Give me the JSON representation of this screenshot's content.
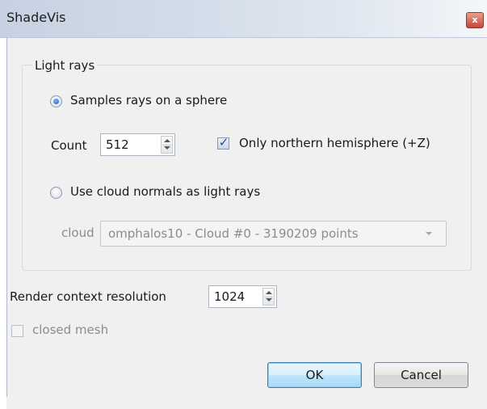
{
  "window": {
    "title": "ShadeVis",
    "close_glyph": "x"
  },
  "light_rays": {
    "group_title": "Light rays",
    "sphere_option": {
      "label": "Samples rays on a sphere",
      "selected": true
    },
    "count": {
      "label": "Count",
      "value": "512"
    },
    "northern": {
      "label": "Only northern hemisphere (+Z)",
      "checked": true
    },
    "normals_option": {
      "label": "Use cloud normals as light rays",
      "selected": false
    },
    "cloud": {
      "label": "cloud",
      "value": "omphalos10 - Cloud #0 - 3190209 points"
    }
  },
  "render": {
    "label": "Render context resolution",
    "value": "1024"
  },
  "closed_mesh": {
    "label": "closed mesh",
    "checked": false
  },
  "buttons": {
    "ok": "OK",
    "cancel": "Cancel"
  },
  "icons": {
    "radio_checked": "radio-checked-icon",
    "radio_unchecked": "radio-unchecked-icon",
    "checkbox_checked": "checkbox-checked-icon",
    "checkbox_unchecked": "checkbox-unchecked-icon",
    "spin_arrows": "spin-arrows-icon",
    "dropdown": "chevron-down-icon",
    "close": "close-icon"
  },
  "colors": {
    "default_button": "#bee6fd",
    "title_bar": "#d3dde9",
    "dialog_bg": "#f0f0f0"
  }
}
